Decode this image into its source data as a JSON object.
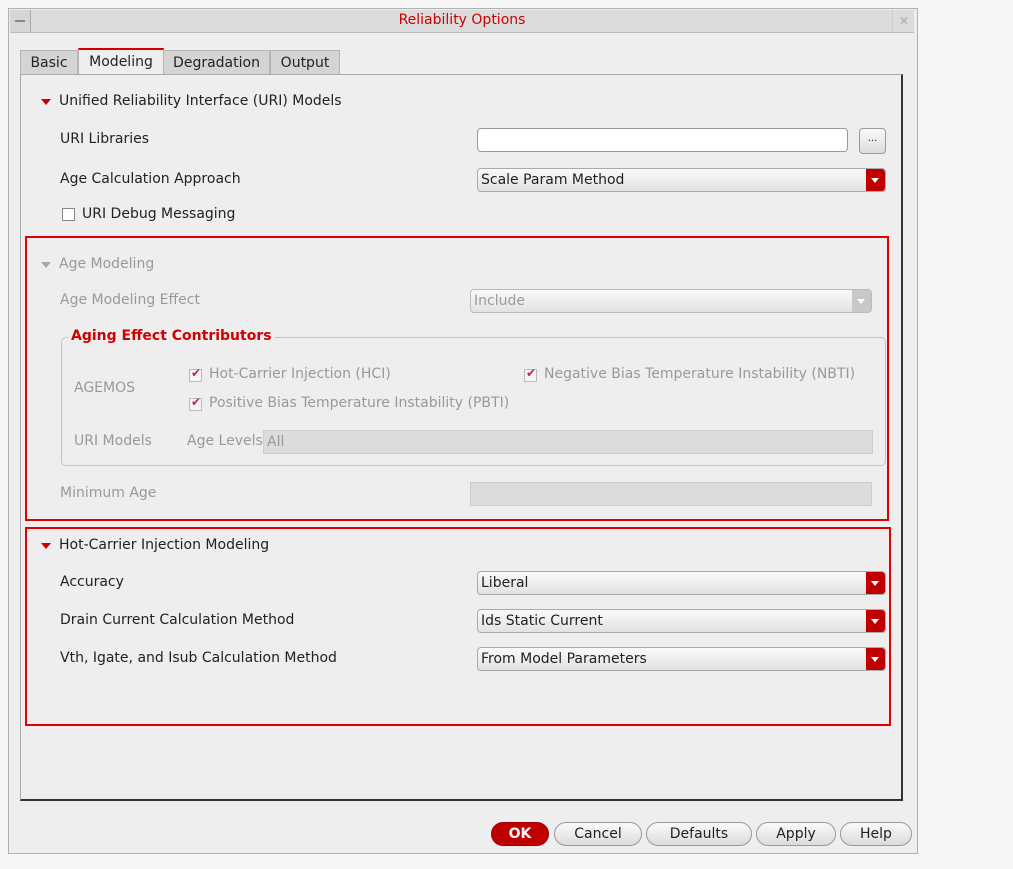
{
  "window": {
    "title": "Reliability Options"
  },
  "tabs": [
    {
      "label": "Basic"
    },
    {
      "label": "Modeling"
    },
    {
      "label": "Degradation"
    },
    {
      "label": "Output"
    }
  ],
  "uri": {
    "section": "Unified Reliability Interface (URI) Models",
    "libraries_label": "URI Libraries",
    "libraries_value": "",
    "browse_label": "...",
    "age_calc_label": "Age Calculation Approach",
    "age_calc_value": "Scale Param Method",
    "debug_label": "URI Debug Messaging"
  },
  "age": {
    "section": "Age Modeling",
    "effect_label": "Age Modeling Effect",
    "effect_value": "Include",
    "contributors_title": "Aging Effect Contributors",
    "agemos_label": "AGEMOS",
    "hci": "Hot-Carrier Injection (HCI)",
    "nbti": "Negative Bias Temperature Instability (NBTI)",
    "pbti": "Positive Bias Temperature Instability (PBTI)",
    "uri_models_label": "URI Models",
    "age_levels_label": "Age Levels",
    "age_levels_value": "All",
    "min_age_label": "Minimum Age",
    "min_age_value": ""
  },
  "hci": {
    "section": "Hot-Carrier Injection Modeling",
    "accuracy_label": "Accuracy",
    "accuracy_value": "Liberal",
    "drain_label": "Drain Current Calculation Method",
    "drain_value": "Ids Static Current",
    "vth_label": "Vth, Igate, and Isub Calculation Method",
    "vth_value": "From Model Parameters"
  },
  "buttons": {
    "ok": "OK",
    "cancel": "Cancel",
    "defaults": "Defaults",
    "apply": "Apply",
    "help": "Help"
  },
  "colors": {
    "accent": "#cc0000",
    "highlight_box": "#e00000"
  }
}
